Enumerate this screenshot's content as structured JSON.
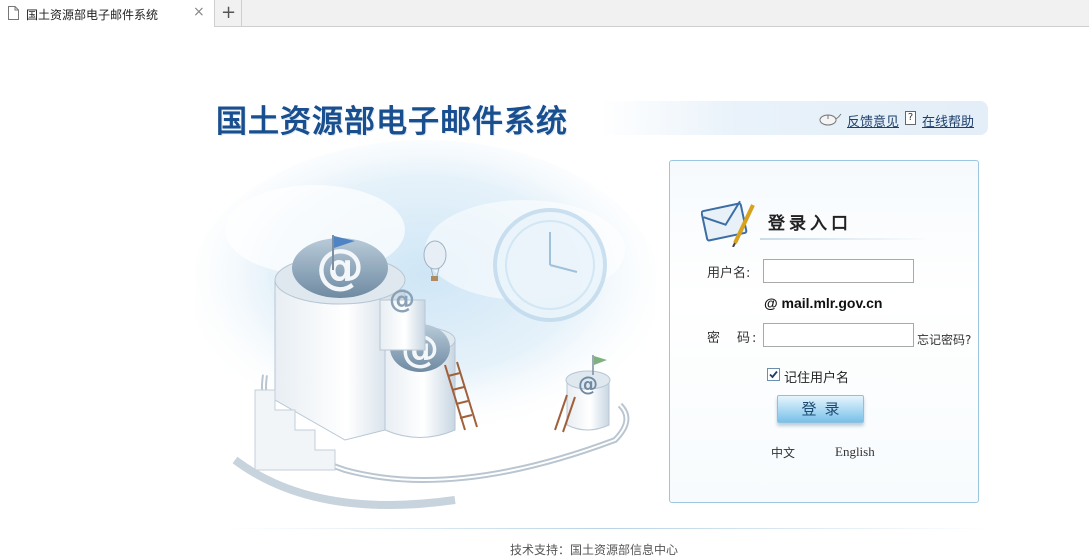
{
  "browser": {
    "tab_title": "国土资源部电子邮件系统",
    "tab_close": "×",
    "new_tab": "+"
  },
  "header": {
    "title": "国土资源部电子邮件系统",
    "feedback_link": "反馈意见",
    "help_link": "在线帮助",
    "help_icon_glyph": "?"
  },
  "login": {
    "heading": "登录入口",
    "username_label": "用户名:",
    "username_value": "",
    "domain": "@ mail.mlr.gov.cn",
    "password_label": "密　码:",
    "password_value": "",
    "forgot_password": "忘记密码?",
    "remember_label": "记住用户名",
    "remember_checked": true,
    "submit_label": "登录",
    "lang_chinese": "中文",
    "lang_english": "English"
  },
  "footer": {
    "support_text": "技术支持：国土资源部信息中心"
  },
  "colors": {
    "title_blue": "#1a4f8f",
    "panel_border": "#9cc6df",
    "button_blue": "#79c0ea"
  },
  "icons": {
    "tab": "page-icon",
    "feedback": "feedback-mouse-icon",
    "help": "help-document-icon",
    "login": "envelope-pencil-icon",
    "checkbox": "check-icon"
  }
}
